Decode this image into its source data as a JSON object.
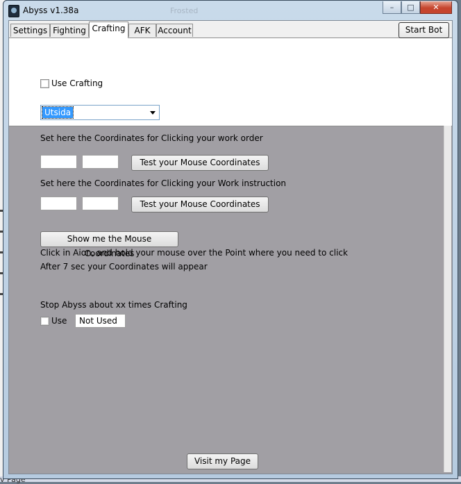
{
  "window": {
    "title": "Abyss v1.38a",
    "ghost_title": "Frosted",
    "controls": {
      "minimize": "–",
      "maximize": "□",
      "close": "✕"
    }
  },
  "tabs": [
    "Settings",
    "Fighting",
    "Crafting",
    "AFK",
    "Account"
  ],
  "active_tab": "Crafting",
  "start_bot_label": "Start Bot",
  "crafting": {
    "use_crafting_label": "Use Crafting",
    "use_crafting_checked": false,
    "profession_selected": "Utsida",
    "work_order": {
      "label": "Set here the Coordinates for Clicking your work order",
      "x_value": "",
      "y_value": "",
      "test_button": "Test your Mouse Coordinates"
    },
    "work_instruction": {
      "label": "Set here the Coordinates for Clicking your Work instruction",
      "x_value": "",
      "y_value": "",
      "test_button": "Test your Mouse Coordinates"
    },
    "show_coords_button": "Show me the Mouse Coordinates",
    "instruction_line1": "Click in Aion, and hold your mouse over the Point where you need to click",
    "instruction_line2": "After 7 sec your Coordinates will appear",
    "stop_label": "Stop Abyss about xx times Crafting",
    "stop_use_label": "Use",
    "stop_use_checked": false,
    "stop_value": "Not Used"
  },
  "visit_button": "Visit my Page",
  "background_peek_text": "v Page"
}
